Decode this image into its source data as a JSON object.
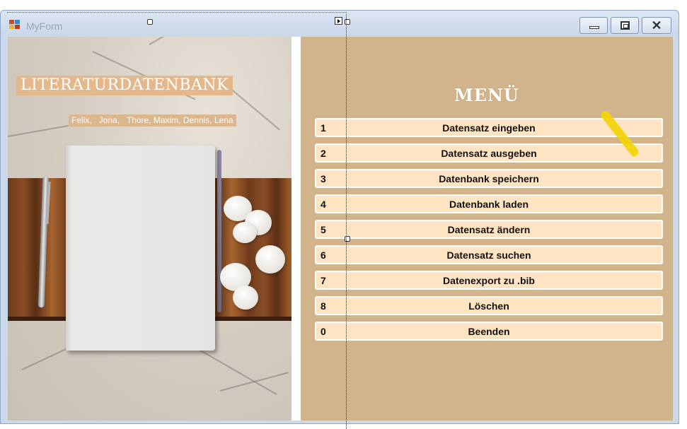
{
  "window": {
    "title": "MyForm",
    "minimize_icon": "minimize-icon",
    "maximize_icon": "maximize-icon",
    "close_icon": "close-icon"
  },
  "cover": {
    "title": "LITERATURDATENBANK",
    "authors": "Felix,   Jona,   Thore, Maxim, Dennis, Lena"
  },
  "menu": {
    "heading": "MENÜ",
    "items": [
      {
        "number": "1",
        "label": "Datensatz eingeben"
      },
      {
        "number": "2",
        "label": "Datensatz ausgeben"
      },
      {
        "number": "3",
        "label": "Datenbank speichern"
      },
      {
        "number": "4",
        "label": "Datenbank laden"
      },
      {
        "number": "5",
        "label": "Datensatz ändern"
      },
      {
        "number": "6",
        "label": "Datensatz suchen"
      },
      {
        "number": "7",
        "label": "Datenexport zu .bib"
      },
      {
        "number": "8",
        "label": "Löschen"
      },
      {
        "number": "0",
        "label": "Beenden"
      }
    ]
  },
  "colors": {
    "panel_bg": "#d2b48c",
    "button_bg": "#ffe4c4",
    "title_bg": "#e2b88c"
  }
}
